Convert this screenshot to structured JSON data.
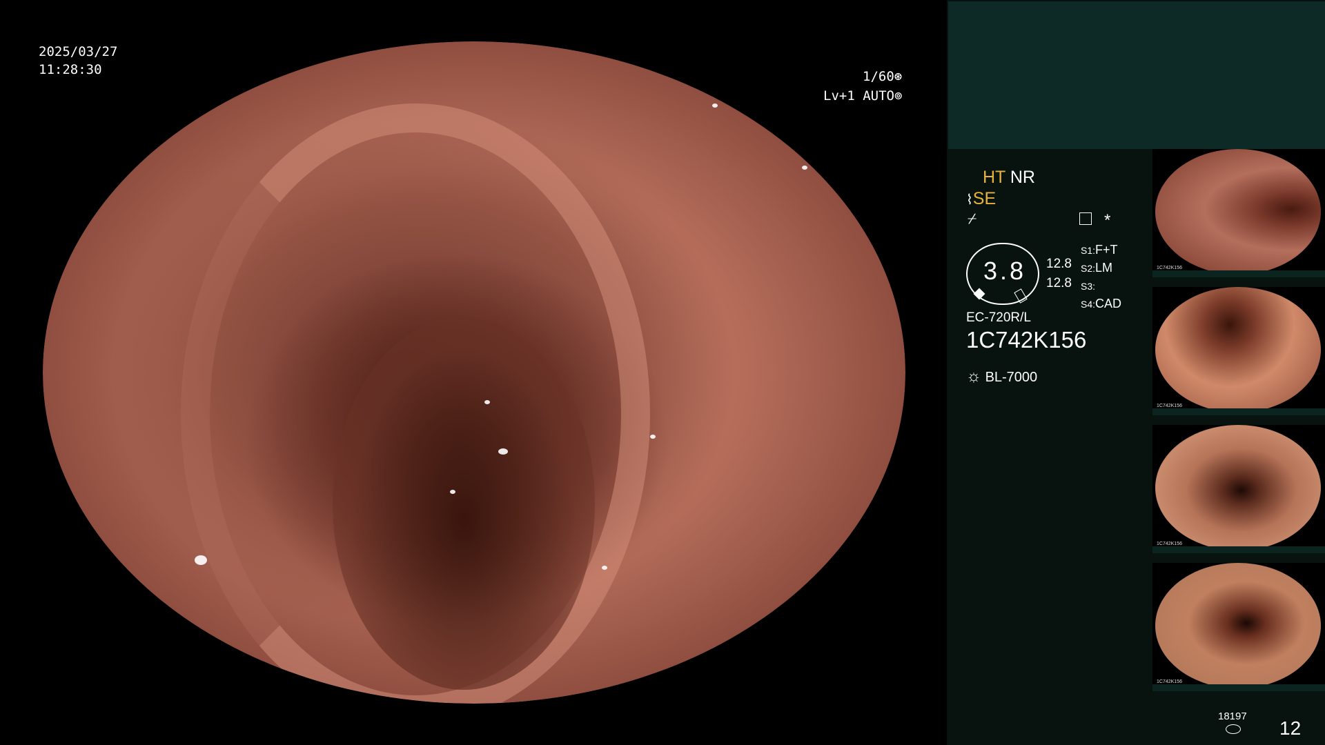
{
  "overlay": {
    "date": "2025/03/27",
    "time": "11:28:30",
    "shutter": "1/60",
    "level": "Lv+1",
    "iris_mode": "AUTO"
  },
  "panel": {
    "mode_ht": "HT",
    "mode_nr": "NR",
    "mode_se": "SE",
    "gauge_value": "3.8",
    "gauge_side_top": "12.8",
    "gauge_side_bottom": "12.8",
    "switches": [
      {
        "key": "S1",
        "value": "F+T"
      },
      {
        "key": "S2",
        "value": "LM"
      },
      {
        "key": "S3",
        "value": ""
      },
      {
        "key": "S4",
        "value": "CAD"
      }
    ],
    "asterisk": "*",
    "scope_model": "EC-720R/L",
    "scope_serial": "1C742K156",
    "light_source": "BL-7000",
    "storage_count": "18197",
    "image_count": "12"
  },
  "thumbnails": [
    {
      "serial": "1C742K156"
    },
    {
      "serial": "1C742K156"
    },
    {
      "serial": "1C742K156"
    },
    {
      "serial": "1C742K156"
    }
  ],
  "colors": {
    "panel_bg": "#081310",
    "panel_top_bg": "#0e2a26",
    "accent_yellow": "#e8b23c"
  }
}
